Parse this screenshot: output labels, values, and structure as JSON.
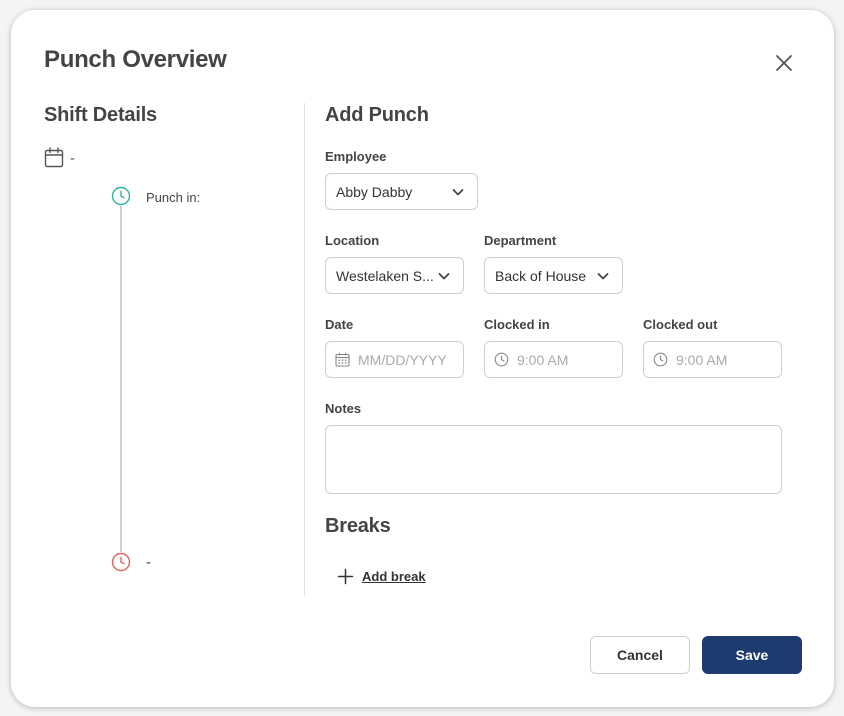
{
  "dialog": {
    "title": "Punch Overview"
  },
  "shift_details": {
    "title": "Shift Details",
    "date_value": "-",
    "punch_in_label": "Punch in:",
    "punch_out_value": "-"
  },
  "add_punch": {
    "title": "Add Punch",
    "employee": {
      "label": "Employee",
      "value": "Abby Dabby"
    },
    "location": {
      "label": "Location",
      "value": "Westelaken S..."
    },
    "department": {
      "label": "Department",
      "value": "Back of House"
    },
    "date": {
      "label": "Date",
      "placeholder": "MM/DD/YYYY"
    },
    "clocked_in": {
      "label": "Clocked in",
      "placeholder": "9:00 AM"
    },
    "clocked_out": {
      "label": "Clocked out",
      "placeholder": "9:00 AM"
    },
    "notes": {
      "label": "Notes",
      "value": ""
    }
  },
  "breaks": {
    "title": "Breaks",
    "add_label": "Add break"
  },
  "footer": {
    "cancel_label": "Cancel",
    "save_label": "Save"
  },
  "colors": {
    "primary": "#1d3b6f",
    "punch_in_icon": "#2bb3a0",
    "punch_out_icon": "#e0625f",
    "border": "#cfcfcf"
  },
  "icons": {
    "close": "close-icon",
    "calendar": "calendar-icon",
    "clock": "clock-icon",
    "chevron": "chevron-down-icon",
    "plus": "plus-icon"
  }
}
